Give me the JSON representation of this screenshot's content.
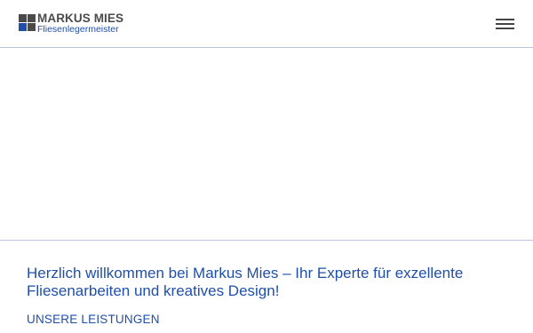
{
  "header": {
    "logo": {
      "name": "MARKUS MIES",
      "subtitle": "Fliesenlegermeister"
    },
    "menu_icon": "hamburger-menu-icon"
  },
  "main": {
    "welcome_text": "Herzlich willkommen bei Markus Mies – Ihr Experte für exzellente Fliesenarbeiten und kreatives Design!",
    "services_link": "UNSERE LEISTUNGEN"
  },
  "colors": {
    "brand_blue": "#1f4fa8",
    "logo_gray": "#4a4a4a",
    "divider": "#b9c4d6"
  }
}
